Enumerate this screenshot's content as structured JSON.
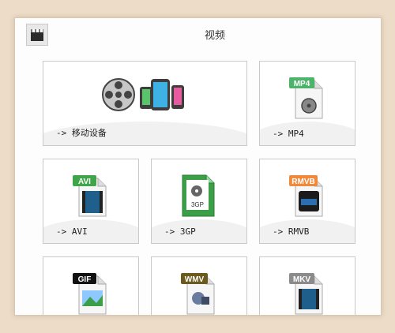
{
  "header": {
    "title": "视频",
    "icon": "film-clapper-icon"
  },
  "tiles": [
    {
      "name": "tile-mobile",
      "label": "-> 移动设备",
      "icon": "film-reel-and-phones-icon"
    },
    {
      "name": "tile-mp4",
      "label": "-> MP4",
      "icon": "mp4-file-icon",
      "badge": "MP4",
      "badge_color": "#4db36b"
    },
    {
      "name": "tile-avi",
      "label": "-> AVI",
      "icon": "avi-file-icon",
      "badge": "AVI",
      "badge_color": "#3fa54a"
    },
    {
      "name": "tile-3gp",
      "label": "-> 3GP",
      "icon": "3gp-file-icon",
      "badge": "3GP",
      "badge_color": "#2f9a3e"
    },
    {
      "name": "tile-rmvb",
      "label": "-> RMVB",
      "icon": "rmvb-file-icon",
      "badge": "RMVB",
      "badge_color": "#f08a3a"
    },
    {
      "name": "tile-gif",
      "label": "",
      "icon": "gif-file-icon",
      "badge": "GIF",
      "badge_color": "#111111"
    },
    {
      "name": "tile-wmv",
      "label": "",
      "icon": "wmv-file-icon",
      "badge": "WMV",
      "badge_color": "#6b5a1d"
    },
    {
      "name": "tile-mkv",
      "label": "",
      "icon": "mkv-file-icon",
      "badge": "MKV",
      "badge_color": "#8b8b8b"
    }
  ]
}
